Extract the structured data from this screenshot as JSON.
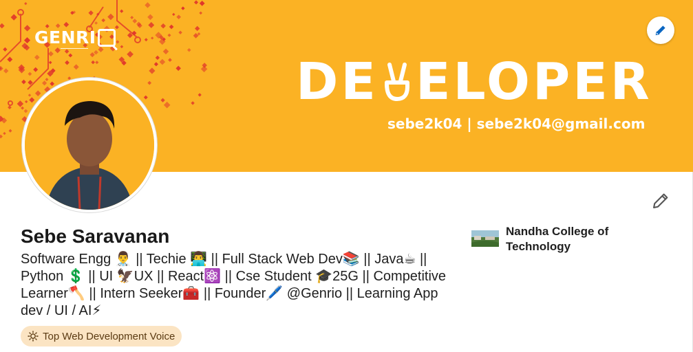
{
  "banner": {
    "brand": "GENRI",
    "headline_left": "DE",
    "headline_right": "ELOPER",
    "contact": "sebe2k04 | sebe2k04@gmail.com",
    "background_color": "#fbb224",
    "pattern_color": "#e0362b"
  },
  "profile": {
    "name": "Sebe Saravanan",
    "headline": "Software Engg 👨‍⚕️ || Techie 👨‍💻 || Full Stack Web Dev📚 || Java☕ || Python 💲 || UI 🦅UX || React⚛️ || Cse Student 🎓25G || Competitive Learner🪓 || Intern Seeker🧰 || Founder🖊️ @Genrio || Learning App dev / UI / AI⚡",
    "badge": "Top Web Development Voice"
  },
  "education": {
    "name": "Nandha College of Technology"
  },
  "icons": {
    "banner_edit": "pencil-icon",
    "profile_edit": "pencil-icon",
    "badge": "lightbulb-icon"
  },
  "colors": {
    "accent_blue": "#0a66c2",
    "badge_bg": "#fbe4c3"
  }
}
